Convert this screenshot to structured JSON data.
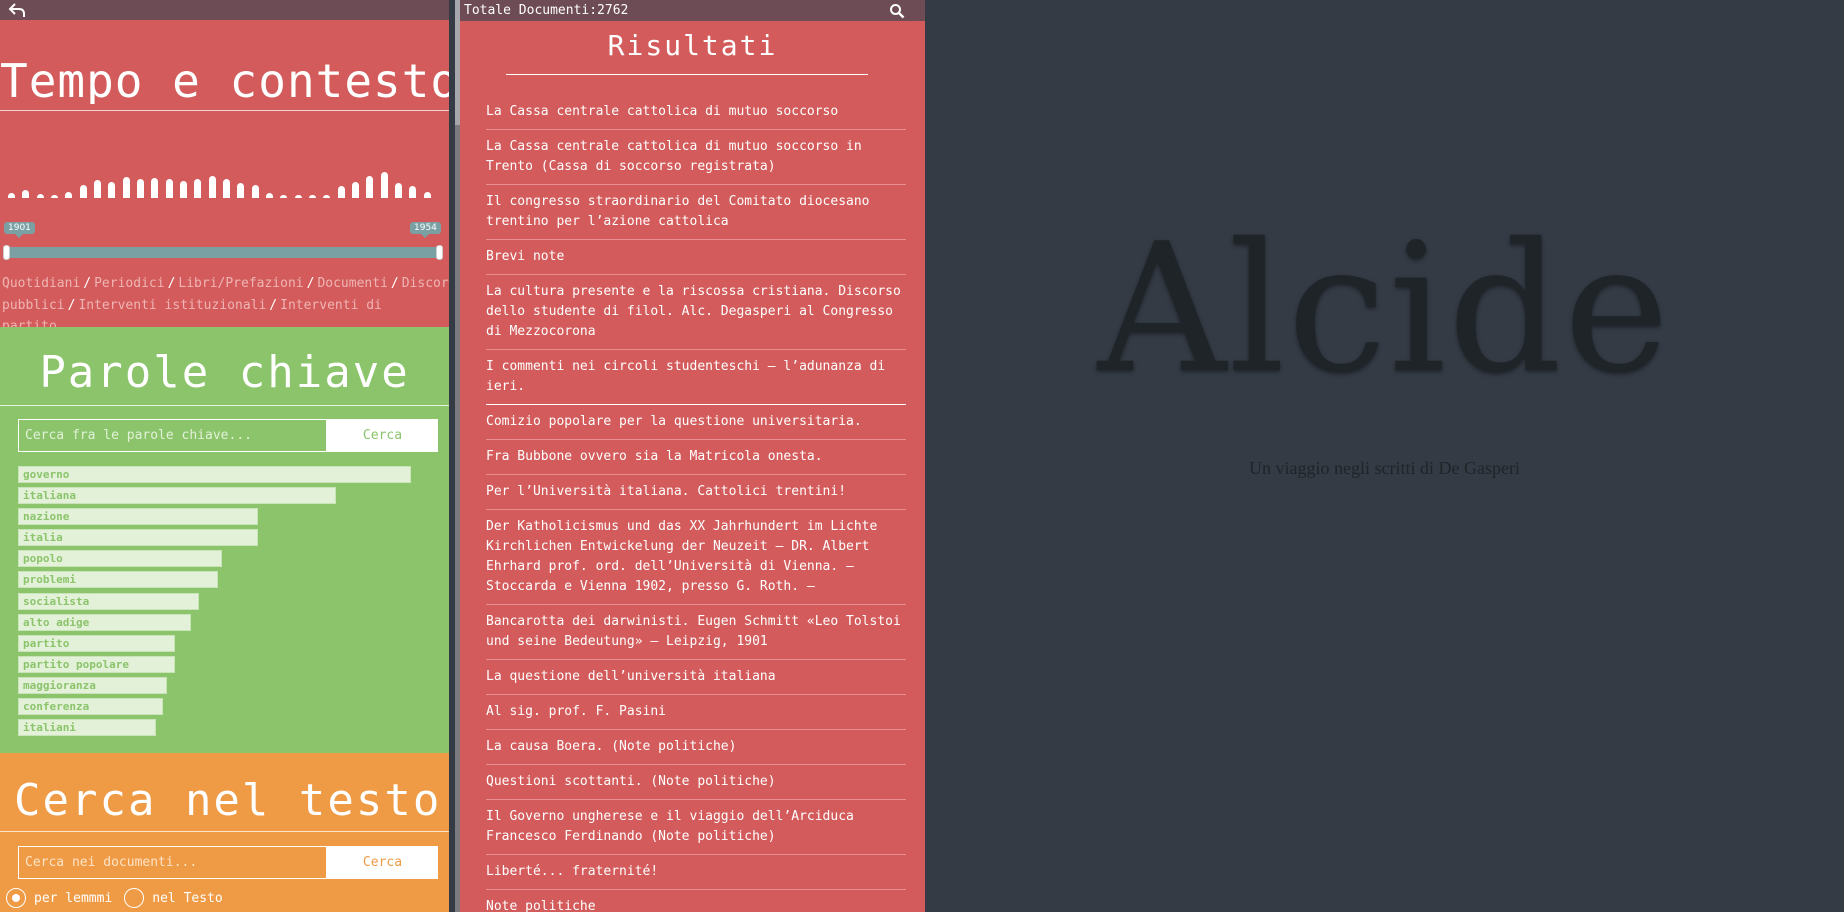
{
  "left": {
    "tempo": {
      "title": "Tempo e contesto",
      "histogram": [
        0.15,
        0.25,
        0.12,
        0.1,
        0.18,
        0.4,
        0.55,
        0.5,
        0.65,
        0.6,
        0.62,
        0.58,
        0.52,
        0.6,
        0.7,
        0.58,
        0.48,
        0.4,
        0.15,
        0.05,
        0.05,
        0.05,
        0.05,
        0.38,
        0.5,
        0.7,
        0.82,
        0.48,
        0.38,
        0.2
      ],
      "slider_min": "1901",
      "slider_max": "1954",
      "doc_types": [
        "Quotidiani",
        "Periodici",
        "Libri/Prefazioni",
        "Documenti",
        "Discorsi pubblici",
        "Interventi istituzionali",
        "Interventi di partito"
      ]
    },
    "parole": {
      "title": "Parole chiave",
      "placeholder": "Cerca fra le parole chiave...",
      "button": "Cerca",
      "keywords": [
        {
          "label": "governo",
          "value": 1.0
        },
        {
          "label": "italiana",
          "value": 0.81
        },
        {
          "label": "nazione",
          "value": 0.61
        },
        {
          "label": "italia",
          "value": 0.61
        },
        {
          "label": "popolo",
          "value": 0.52
        },
        {
          "label": "problemi",
          "value": 0.51
        },
        {
          "label": "socialista",
          "value": 0.46
        },
        {
          "label": "alto adige",
          "value": 0.44
        },
        {
          "label": "partito",
          "value": 0.4
        },
        {
          "label": "partito popolare",
          "value": 0.4
        },
        {
          "label": "maggioranza",
          "value": 0.38
        },
        {
          "label": "conferenza",
          "value": 0.37
        },
        {
          "label": "italiani",
          "value": 0.35
        }
      ]
    },
    "cerca": {
      "title": "Cerca nel testo",
      "placeholder": "Cerca nei documenti...",
      "button": "Cerca",
      "radio_lemmi": "per lemmmi",
      "radio_testo": "nel Testo"
    }
  },
  "middle": {
    "total_label": "Totale Documenti:2762",
    "title": "Risultati",
    "results": [
      "La Cassa centrale cattolica di mutuo soccorso",
      "La Cassa centrale cattolica di mutuo soccorso in Trento (Cassa di soccorso registrata)",
      "Il congresso straordinario del Comitato diocesano trentino per l’azione cattolica",
      "Brevi note",
      "La cultura presente e la riscossa cristiana. Discorso dello studente di filol. Alc. Degasperi al Congresso di Mezzocorona",
      "I commenti nei circoli studenteschi – l’adunanza di ieri.",
      "Comizio popolare per la questione universitaria.",
      "Fra Bubbone ovvero sia la Matricola onesta.",
      "Per l’Università italiana. Cattolici trentini!",
      "Der Katholicismus und das XX Jahrhundert im Lichte Kirchlichen Entwickelung der Neuzeit – DR. Albert Ehrhard prof. ord. dell’Università di Vienna. – Stoccarda e Vienna 1902, presso G. Roth. –",
      "Bancarotta dei darwinisti. Eugen Schmitt «Leo Tolstoi und seine Bedeutung» – Leipzig, 1901",
      "La questione dell’università italiana",
      "Al sig. prof. F. Pasini",
      "La causa Boera. (Note politiche)",
      "Questioni scottanti. (Note politiche)",
      "Il Governo ungherese e il viaggio dell’Arciduca Francesco Ferdinando (Note politiche)",
      "Liberté... fraternité!",
      "Note politiche"
    ]
  },
  "right": {
    "brand": "Alcide",
    "tagline": "Un viaggio negli scritti di De Gasperi"
  },
  "colors": {
    "red": "#d35b5b",
    "green": "#8bc46b",
    "orange": "#ef9b45",
    "dark": "#343b45",
    "bar": "#6d4c55"
  }
}
